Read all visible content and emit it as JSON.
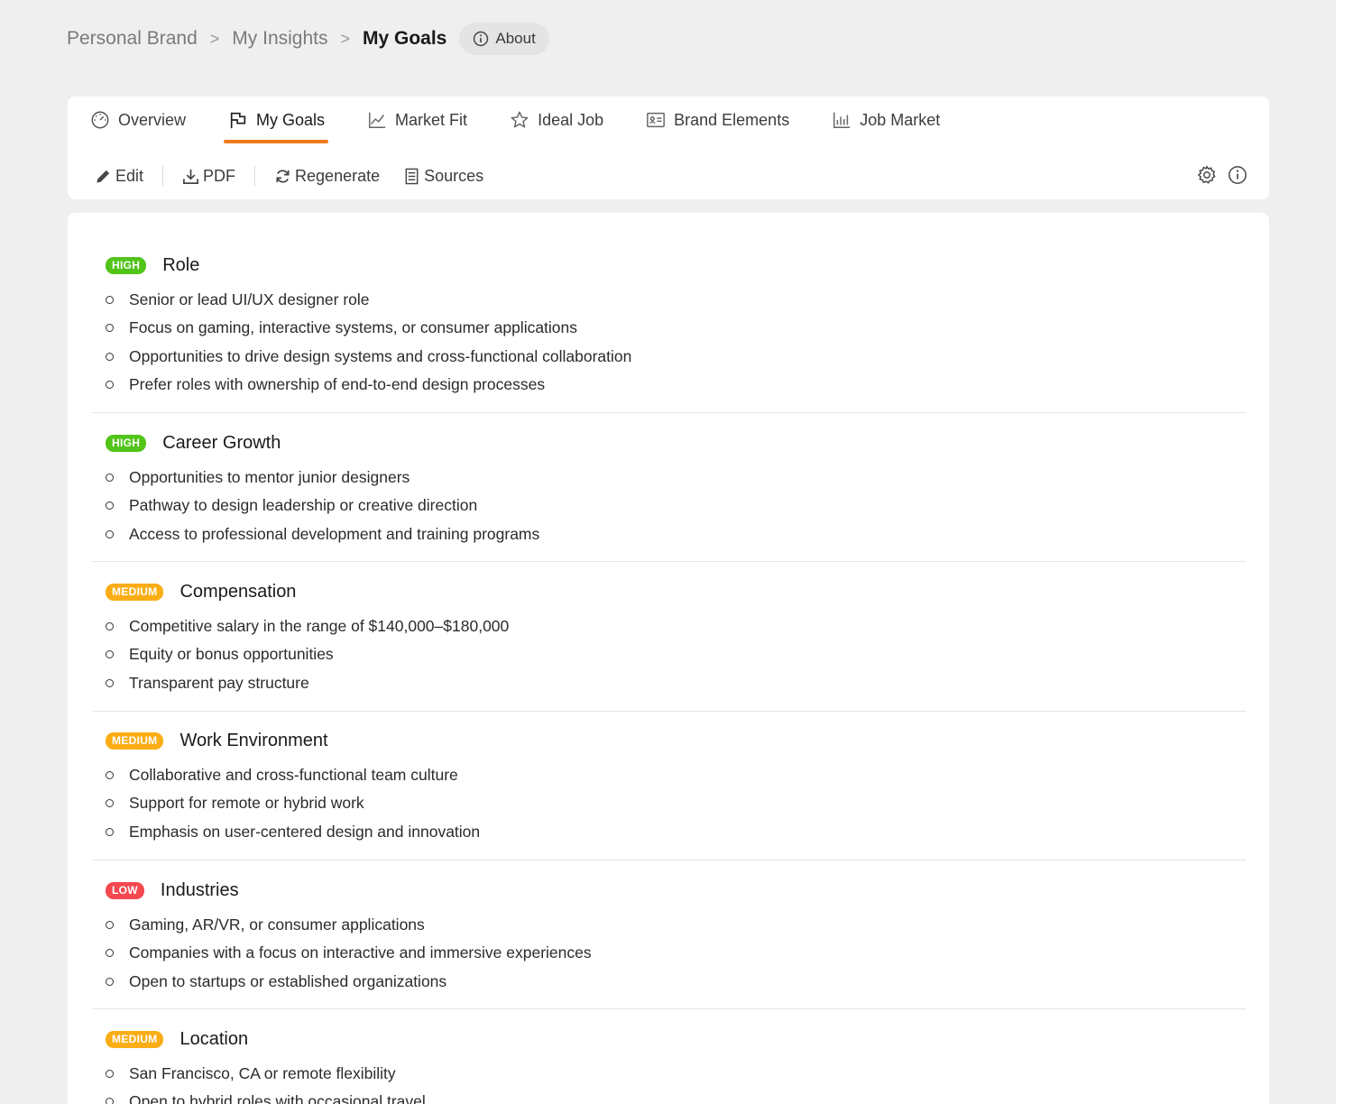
{
  "breadcrumb": {
    "items": [
      "Personal Brand",
      "My Insights"
    ],
    "separator": ">",
    "current": "My Goals",
    "about_label": "About"
  },
  "tabs": [
    {
      "label": "Overview",
      "icon": "gauge-icon"
    },
    {
      "label": "My Goals",
      "icon": "flag-icon",
      "active": true
    },
    {
      "label": "Market Fit",
      "icon": "line-chart-icon"
    },
    {
      "label": "Ideal Job",
      "icon": "star-icon"
    },
    {
      "label": "Brand Elements",
      "icon": "id-card-icon"
    },
    {
      "label": "Job Market",
      "icon": "bar-chart-icon"
    }
  ],
  "toolbar": {
    "edit_label": "Edit",
    "pdf_label": "PDF",
    "regenerate_label": "Regenerate",
    "sources_label": "Sources"
  },
  "colors": {
    "accent": "#f07a1a",
    "high": "#52c41a",
    "medium": "#faad14",
    "low": "#f5484f"
  },
  "goals": [
    {
      "priority": "HIGH",
      "title": "Role",
      "items": [
        "Senior or lead UI/UX designer role",
        "Focus on gaming, interactive systems, or consumer applications",
        "Opportunities to drive design systems and cross-functional collaboration",
        "Prefer roles with ownership of end-to-end design processes"
      ]
    },
    {
      "priority": "HIGH",
      "title": "Career Growth",
      "items": [
        "Opportunities to mentor junior designers",
        "Pathway to design leadership or creative direction",
        "Access to professional development and training programs"
      ]
    },
    {
      "priority": "MEDIUM",
      "title": "Compensation",
      "items": [
        "Competitive salary in the range of $140,000–$180,000",
        "Equity or bonus opportunities",
        "Transparent pay structure"
      ]
    },
    {
      "priority": "MEDIUM",
      "title": "Work Environment",
      "items": [
        "Collaborative and cross-functional team culture",
        "Support for remote or hybrid work",
        "Emphasis on user-centered design and innovation"
      ]
    },
    {
      "priority": "LOW",
      "title": "Industries",
      "items": [
        "Gaming, AR/VR, or consumer applications",
        "Companies with a focus on interactive and immersive experiences",
        "Open to startups or established organizations"
      ]
    },
    {
      "priority": "MEDIUM",
      "title": "Location",
      "items": [
        "San Francisco, CA or remote flexibility",
        "Open to hybrid roles with occasional travel"
      ]
    }
  ]
}
